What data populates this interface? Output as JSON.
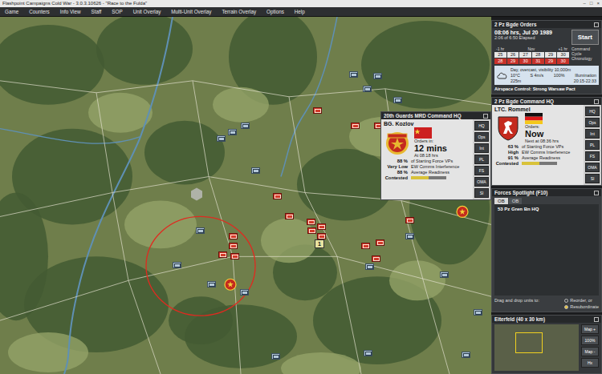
{
  "window": {
    "title": "Flashpoint Campaigns Cold War - 3.0.3.10626 - \"Race to the Fulda\"",
    "controls": [
      "–",
      "□",
      "×"
    ]
  },
  "menu": [
    {
      "label": "Game",
      "selected": false
    },
    {
      "label": "Counters",
      "selected": false
    },
    {
      "label": "Info View",
      "selected": false
    },
    {
      "label": "Staff",
      "selected": false
    },
    {
      "label": "SOP",
      "selected": false
    },
    {
      "label": "Unit Overlay",
      "selected": false
    },
    {
      "label": "Multi-Unit Overlay",
      "selected": false
    },
    {
      "label": "Terrain Overlay",
      "selected": false
    },
    {
      "label": "Options",
      "selected": false
    },
    {
      "label": "Help",
      "selected": false
    }
  ],
  "map": {
    "range_ring_color": "#e02a20",
    "stack_label": "1",
    "units": [
      {
        "side": "nato",
        "color": "#b4c8d8"
      },
      {
        "side": "nato",
        "color": "#b4c8d8"
      },
      {
        "side": "nato",
        "color": "#b4c8d8"
      },
      {
        "side": "nato",
        "color": "#b4c8d8"
      },
      {
        "side": "nato",
        "color": "#b4c8d8"
      },
      {
        "side": "nato",
        "color": "#b4c8d8"
      },
      {
        "side": "nato",
        "color": "#b4c8d8"
      },
      {
        "side": "nato",
        "color": "#b4c8d8"
      },
      {
        "side": "nato",
        "color": "#b4c8d8"
      },
      {
        "side": "nato",
        "color": "#b4c8d8"
      },
      {
        "side": "nato",
        "color": "#b4c8d8"
      },
      {
        "side": "nato",
        "color": "#b4c8d8"
      },
      {
        "side": "nato",
        "color": "#b4c8d8"
      },
      {
        "side": "nato",
        "color": "#b4c8d8"
      },
      {
        "side": "nato",
        "color": "#b4c8d8"
      },
      {
        "side": "nato",
        "color": "#b4c8d8"
      },
      {
        "side": "nato",
        "color": "#b4c8d8"
      },
      {
        "side": "nato",
        "color": "#b4c8d8"
      },
      {
        "side": "nato",
        "color": "#b4c8d8"
      },
      {
        "side": "nato",
        "color": "#b4c8d8"
      },
      {
        "side": "pact",
        "color": "#d23a2a"
      },
      {
        "side": "pact",
        "color": "#d23a2a"
      },
      {
        "side": "pact",
        "color": "#d23a2a"
      },
      {
        "side": "pact",
        "color": "#d23a2a"
      },
      {
        "side": "pact",
        "color": "#d23a2a"
      },
      {
        "side": "pact",
        "color": "#d23a2a"
      },
      {
        "side": "pact",
        "color": "#d23a2a"
      },
      {
        "side": "pact",
        "color": "#d23a2a"
      },
      {
        "side": "pact",
        "color": "#d23a2a"
      },
      {
        "side": "pact",
        "color": "#d23a2a"
      },
      {
        "side": "pact",
        "color": "#d23a2a"
      },
      {
        "side": "pact",
        "color": "#d23a2a"
      },
      {
        "side": "pact",
        "color": "#d23a2a"
      },
      {
        "side": "pact",
        "color": "#d23a2a"
      },
      {
        "side": "pact",
        "color": "#d23a2a"
      },
      {
        "side": "pact",
        "color": "#d23a2a"
      },
      {
        "side": "pact",
        "color": "#d23a2a"
      }
    ]
  },
  "orders": {
    "title": "2 Pz Bgde Orders",
    "time": "08:06 hrs, Jul 20 1989",
    "elapsed": "2:06 of 6:50 Elapsed",
    "start_button": "Start",
    "calendar": {
      "prev": "-1 hr",
      "month": "Nov",
      "next": "+1 hr",
      "days": [
        {
          "label": "25",
          "highlight": false
        },
        {
          "label": "26",
          "highlight": false
        },
        {
          "label": "27",
          "highlight": false
        },
        {
          "label": "28",
          "highlight": false
        },
        {
          "label": "29",
          "highlight": false
        },
        {
          "label": "30",
          "highlight": false
        },
        {
          "label": "28",
          "highlight": true
        },
        {
          "label": "29",
          "highlight": true
        },
        {
          "label": "30",
          "highlight": true
        },
        {
          "label": "31",
          "highlight": true
        },
        {
          "label": "29",
          "highlight": true
        },
        {
          "label": "30",
          "highlight": true
        }
      ]
    },
    "chronology": "Command Cycle Chronology",
    "weather": {
      "summary": "Day, overcast, visibility 10,000m",
      "temp": "10°C",
      "wind": "S 4m/s",
      "humidity": "100%",
      "illumination": "Illumination",
      "cloud": "225m",
      "window": "20:15-22:33"
    },
    "airspace": "Airspace Control:  Strong Warsaw Pact"
  },
  "hqs": [
    {
      "kind": "soviet",
      "title": "20th Guards MRD Command HQ",
      "commander": "BG. Kozlov",
      "orders_label": "Orders in:",
      "orders_value": "12 mins",
      "orders_sub": "At 08:18 hrs",
      "stats": [
        {
          "value": "88 %",
          "label": "of Starting Force VPs"
        },
        {
          "value": "Very Low",
          "label": "EW Comms Interference"
        },
        {
          "value": "88 %",
          "label": "Average Readiness"
        }
      ],
      "control": {
        "value": "Contested",
        "level": 0.5
      },
      "buttons": [
        "HQ",
        "Ops",
        "Int",
        "PL",
        "FS",
        "OMA",
        "SI"
      ]
    },
    {
      "kind": "german",
      "title": "2 Pz Bgde Command HQ",
      "commander": "LTC. Rommel",
      "orders_label": "Orders:",
      "orders_value": "Now",
      "orders_sub": "Next at 08:36 hrs",
      "stats": [
        {
          "value": "63 %",
          "label": "of Starting Force VPs"
        },
        {
          "value": "High",
          "label": "EW Comms Interference"
        },
        {
          "value": "91 %",
          "label": "Average Readiness"
        }
      ],
      "control": {
        "value": "Contested",
        "level": 0.5
      },
      "buttons": [
        "HQ",
        "Ops",
        "Int",
        "PL",
        "FS",
        "OMA",
        "SI"
      ]
    }
  ],
  "spotlight": {
    "title": "Forces Spotlight  (F10)",
    "tabs": [
      {
        "label": "OB",
        "selected": true
      },
      {
        "label": "OB",
        "selected": false
      }
    ],
    "items": [
      {
        "label": "53 Pz Gren Bn HQ",
        "selected": false
      }
    ],
    "drag_label": "Drag and drop units to:",
    "options": [
      {
        "label": "Reorder, or",
        "selected": false
      },
      {
        "label": "Resubordinate",
        "selected": true
      }
    ]
  },
  "minimap": {
    "title": "Eiterfeld (40 x 30 km)",
    "buttons": [
      "Map +",
      "100%",
      "Map -",
      "Hx"
    ]
  }
}
